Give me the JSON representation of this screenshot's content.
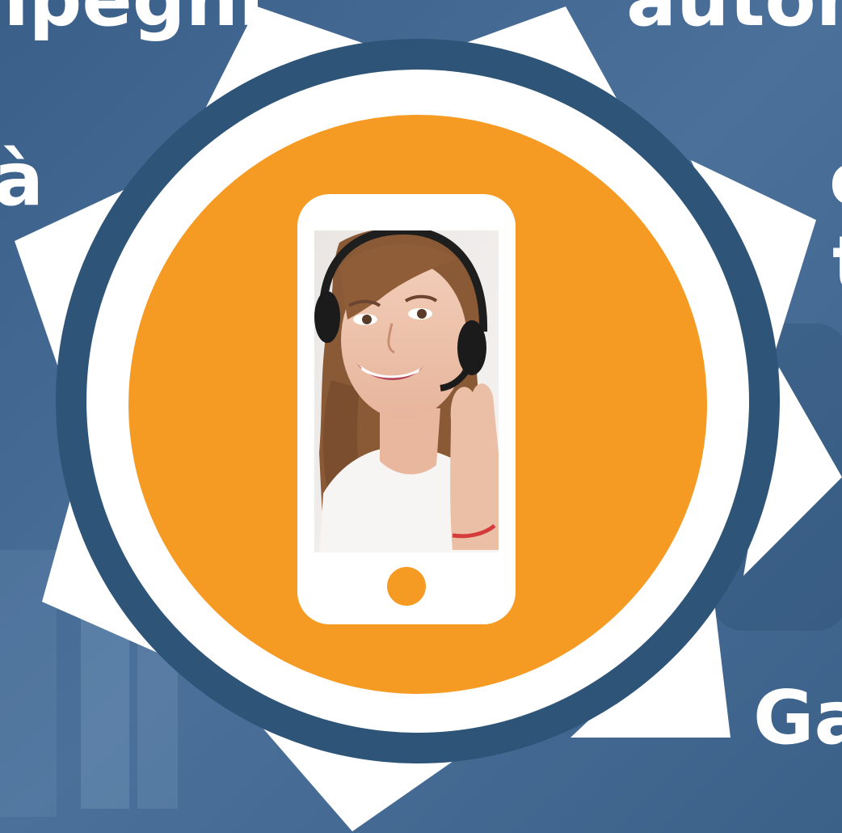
{
  "edge_text": {
    "top_left": "npegni",
    "top_right": "autom",
    "mid_left": "à",
    "right_upper": "c",
    "right_lower": "t",
    "bottom_right": "Ga"
  },
  "colors": {
    "background": "#3f6590",
    "ring_dark": "#2e5478",
    "ring_white": "#ffffff",
    "disc_orange": "#f59a23",
    "phone_white": "#ffffff",
    "home_button": "#f59a23"
  },
  "icons": {
    "phone": "smartphone-icon",
    "person": "headset-operator-photo"
  }
}
